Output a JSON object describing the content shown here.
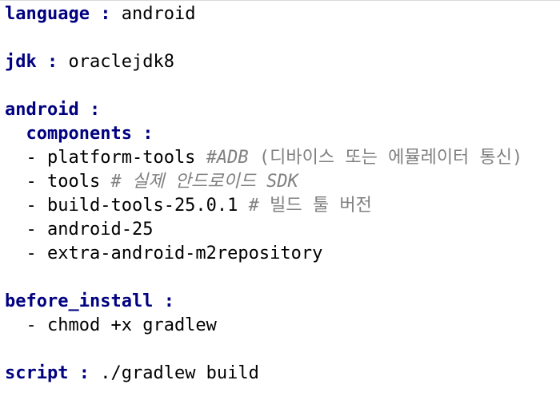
{
  "file": {
    "language_key": "language",
    "language_value": "android",
    "jdk_key": "jdk",
    "jdk_value": "oraclejdk8",
    "android_key": "android",
    "components_key": "components",
    "components": [
      {
        "value": "platform-tools",
        "comment_latin": "#ADB",
        "comment_rest": "(디바이스 또는 에뮬레이터 통신)"
      },
      {
        "value": "tools",
        "comment_latin": "#",
        "comment_rest": "실제 안드로이드 SDK"
      },
      {
        "value": "build-tools-25.0.1",
        "comment_latin": "#",
        "comment_rest": "빌드 툴 버전"
      },
      {
        "value": "android-25",
        "comment_latin": "",
        "comment_rest": ""
      },
      {
        "value": "extra-android-m2repository",
        "comment_latin": "",
        "comment_rest": ""
      }
    ],
    "before_install_key": "before_install",
    "before_install_items": [
      "chmod +x gradlew"
    ],
    "script_key": "script",
    "script_value": "./gradlew build"
  },
  "syntax": {
    "separator": ":",
    "list_dash": "-"
  },
  "colors": {
    "key": "#000080",
    "comment": "#808080",
    "text": "#000000",
    "background": "#ffffff"
  }
}
